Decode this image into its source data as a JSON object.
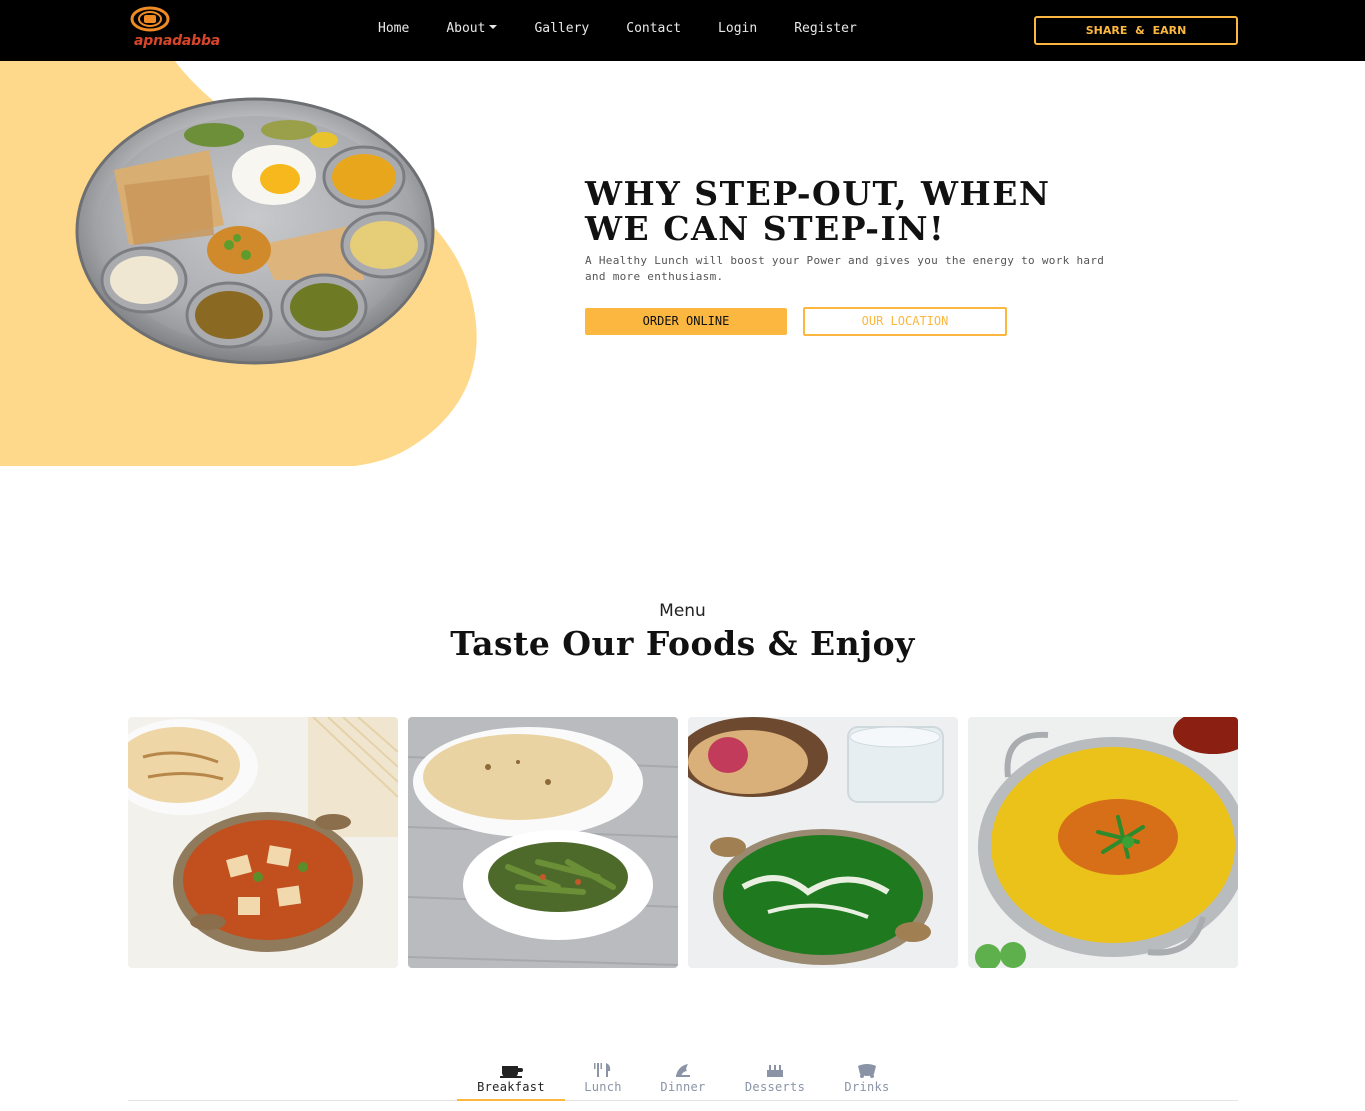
{
  "navbar": {
    "logo_text": "apnadabba",
    "links": [
      {
        "label": "Home",
        "icon": ""
      },
      {
        "label": "About",
        "icon": "caret-down-icon"
      },
      {
        "label": "Gallery",
        "icon": ""
      },
      {
        "label": "Contact",
        "icon": ""
      },
      {
        "label": "Login",
        "icon": ""
      },
      {
        "label": "Register",
        "icon": ""
      }
    ],
    "share_label": "SHARE & EARN"
  },
  "hero": {
    "title_part1": "WHY STEP-OUT, ",
    "title_bold1": "WHEN",
    "title_bold2": "WE",
    "title_part2": " CAN STEP-IN!",
    "subtitle": "A Healthy Lunch will boost your Power and gives you the energy to work hard and more enthusiasm.",
    "order_label": "ORDER ONLINE",
    "location_label": "OUR LOCATION",
    "image": "thali-plate-image"
  },
  "menu": {
    "label": "Menu",
    "title": "Taste Our Foods & Enjoy",
    "cards": [
      {
        "image": "paneer-curry-with-paratha-image"
      },
      {
        "image": "beans-sabzi-with-roti-image"
      },
      {
        "image": "palak-paneer-image"
      },
      {
        "image": "dal-tadka-image"
      }
    ],
    "tabs": [
      {
        "label": "Breakfast",
        "icon": "coffee-cup-icon",
        "active": true
      },
      {
        "label": "Lunch",
        "icon": "utensils-icon",
        "active": false
      },
      {
        "label": "Dinner",
        "icon": "dinner-icon",
        "active": false
      },
      {
        "label": "Desserts",
        "icon": "cake-icon",
        "active": false
      },
      {
        "label": "Drinks",
        "icon": "drinks-icon",
        "active": false
      }
    ]
  },
  "colors": {
    "accent": "#fbb73f",
    "hero_blob": "#ffd98b",
    "navbar_bg": "#000000",
    "logo_red": "#d8452a"
  }
}
